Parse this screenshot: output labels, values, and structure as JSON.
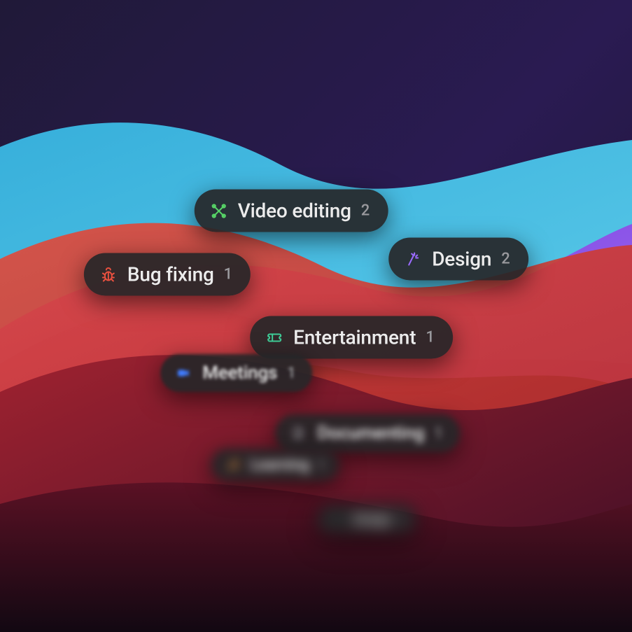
{
  "pills": [
    {
      "key": "video_editing",
      "label": "Video editing",
      "count": 2
    },
    {
      "key": "bug_fixing",
      "label": "Bug fixing",
      "count": 1
    },
    {
      "key": "design",
      "label": "Design",
      "count": 2
    },
    {
      "key": "entertainment",
      "label": "Entertainment",
      "count": 1
    },
    {
      "key": "meetings",
      "label": "Meetings",
      "count": 1
    },
    {
      "key": "documenting",
      "label": "Documenting",
      "count": 1
    },
    {
      "key": "learning",
      "label": "Learning",
      "count": 1
    },
    {
      "key": "design2",
      "label": "Design",
      "count": 1
    }
  ]
}
